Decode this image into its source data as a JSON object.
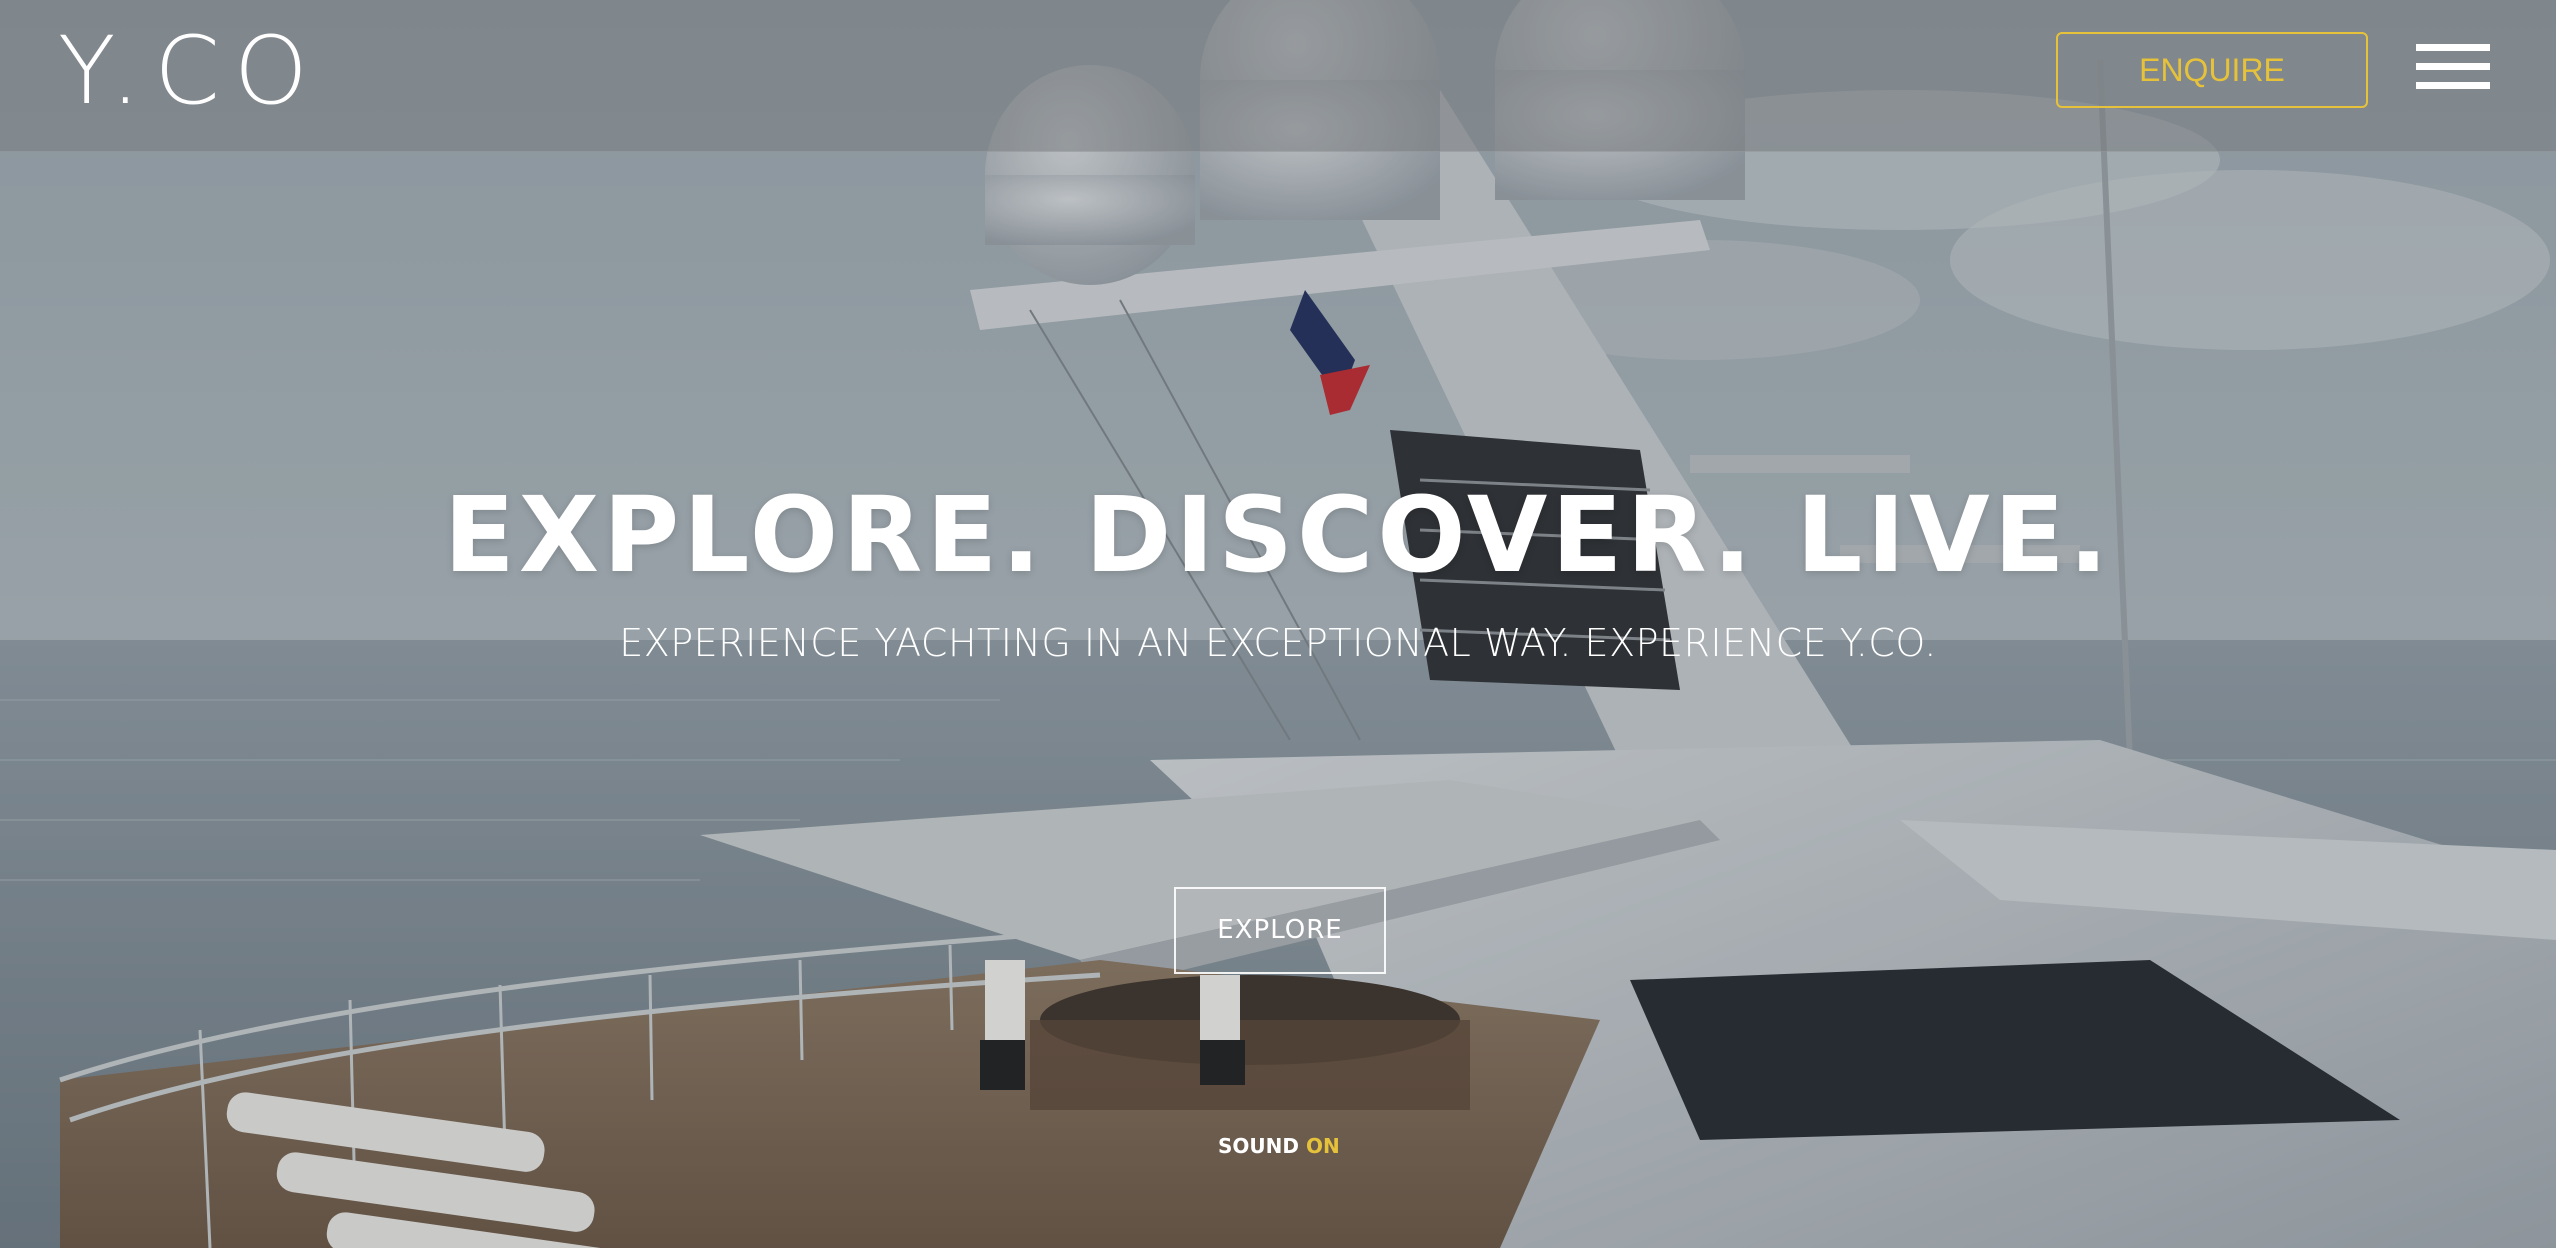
{
  "header": {
    "logo": "Y.CO",
    "enquire_label": "ENQUIRE",
    "menu_icon": "hamburger-menu-icon"
  },
  "hero": {
    "headline": "EXPLORE. DISCOVER. LIVE.",
    "subline": "EXPERIENCE YACHTING IN AN EXCEPTIONAL WAY. EXPERIENCE Y.CO.",
    "explore_label": "EXPLORE",
    "sound_label": "SOUND",
    "sound_state": "ON"
  },
  "colors": {
    "accent": "#e6c23a",
    "text": "#ffffff"
  }
}
